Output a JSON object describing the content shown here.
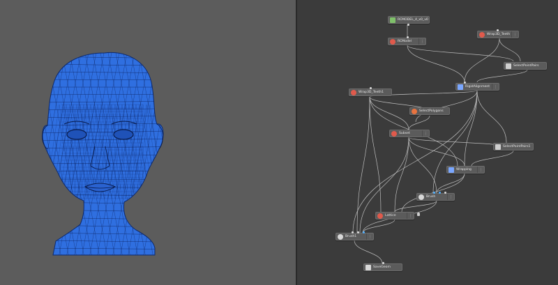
{
  "viewport": {
    "background": "#5c5c5c",
    "mesh_color": "#2f6fe0",
    "wire_color": "#0a1d55"
  },
  "graph": {
    "background": "#3b3b3b",
    "nodes": [
      {
        "id": "rcmodel_file",
        "label": "RCMODEL_4_x0_v0",
        "icon": "file-icon",
        "color": "#7fc06a"
      },
      {
        "id": "rcmodel",
        "label": "RCModel",
        "icon": "model-icon",
        "color": "#e05a4c"
      },
      {
        "id": "wrap_teeth",
        "label": "Wrap3D_Teeth",
        "icon": "model-icon",
        "color": "#e05a4c"
      },
      {
        "id": "selpoint",
        "label": "SelectPointPairs",
        "icon": "points-icon",
        "color": "#cfcfcf"
      },
      {
        "id": "rigid",
        "label": "RigidAlignment",
        "icon": "align-icon",
        "color": "#7aa7ff"
      },
      {
        "id": "wrap_teeth1",
        "label": "Wrap3D_Teeth1",
        "icon": "model-icon",
        "color": "#e05a4c"
      },
      {
        "id": "selpoly",
        "label": "SelectPolygons",
        "icon": "polygon-icon",
        "color": "#e8733f"
      },
      {
        "id": "subset",
        "label": "Subset",
        "icon": "subset-icon",
        "color": "#e05a4c"
      },
      {
        "id": "selpoint1",
        "label": "SelectPointPairs1",
        "icon": "points-icon",
        "color": "#cfcfcf"
      },
      {
        "id": "wrapping",
        "label": "Wrapping",
        "icon": "wrap-icon",
        "color": "#7aa7ff"
      },
      {
        "id": "brush",
        "label": "Brush",
        "icon": "brush-icon",
        "color": "#d8d8d8"
      },
      {
        "id": "lattice",
        "label": "Lattice",
        "icon": "lattice-icon",
        "color": "#e05a4c"
      },
      {
        "id": "brush1",
        "label": "Brush1",
        "icon": "brush-icon",
        "color": "#d8d8d8"
      },
      {
        "id": "savegeom",
        "label": "SaveGeom",
        "icon": "save-icon",
        "color": "#d8d8d8"
      }
    ]
  }
}
